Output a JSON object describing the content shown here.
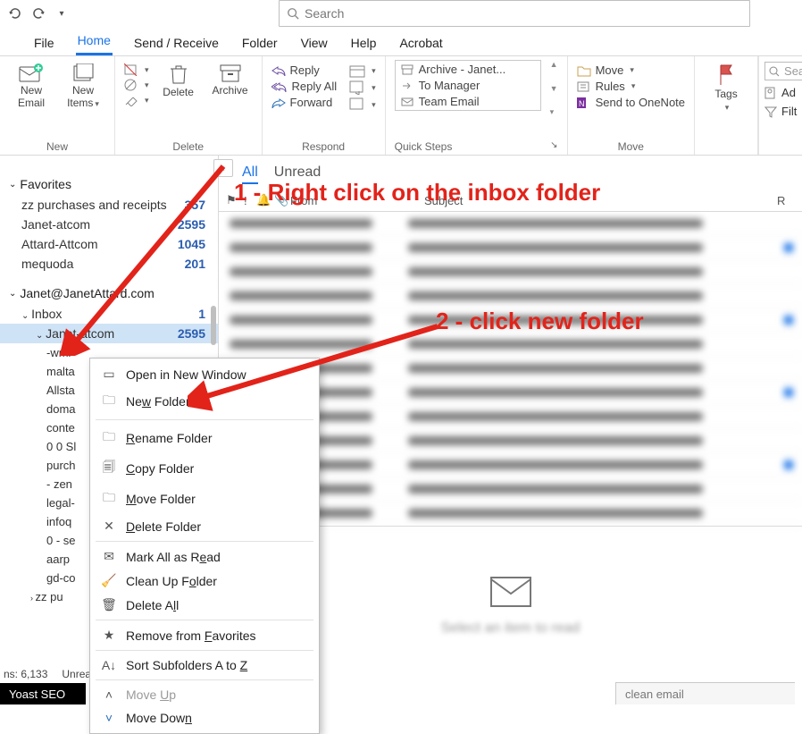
{
  "qat": {
    "search_placeholder": "Search"
  },
  "tabs": {
    "file": "File",
    "home": "Home",
    "sendreceive": "Send / Receive",
    "folder": "Folder",
    "view": "View",
    "help": "Help",
    "acrobat": "Acrobat"
  },
  "ribbon": {
    "new_email": "New Email",
    "new_items": "New Items",
    "delete": "Delete",
    "archive": "Archive",
    "reply": "Reply",
    "reply_all": "Reply All",
    "forward": "Forward",
    "qs_archive": "Archive - Janet...",
    "qs_tomgr": "To Manager",
    "qs_team": "Team Email",
    "move": "Move",
    "rules": "Rules",
    "onenote": "Send to OneNote",
    "tags": "Tags",
    "search_ph": "Search",
    "addr": "Ad",
    "filt": "Filt",
    "grp_new": "New",
    "grp_delete": "Delete",
    "grp_respond": "Respond",
    "grp_qs": "Quick Steps",
    "grp_move": "Move"
  },
  "nav": {
    "favorites_label": "Favorites",
    "fav_items": [
      {
        "label": "zz purchases and receipts",
        "count": "357"
      },
      {
        "label": "Janet-atcom",
        "count": "2595"
      },
      {
        "label": "Attard-Attcom",
        "count": "1045"
      },
      {
        "label": "mequoda",
        "count": "201"
      }
    ],
    "account": "Janet@JanetAttard.com",
    "inbox": {
      "label": "Inbox",
      "count": "1"
    },
    "janet_atcom": {
      "label": "Janet-atcom",
      "count": "2595"
    },
    "subfolders": [
      "-wml",
      "malta",
      "Allsta",
      "doma",
      "conte",
      "0 0 Sl",
      "purch",
      "- zen",
      "legal-",
      "infoq",
      "0 - se",
      "aarp",
      "gd-co"
    ],
    "zzpu": "zz pu"
  },
  "list": {
    "all": "All",
    "unread": "Unread",
    "from": "From",
    "subject": "Subject",
    "rec": "R"
  },
  "reading_hint": "Select an item to read",
  "ctx": {
    "open": "Open in New Window",
    "newfolder": "New Folder...",
    "rename": "Rename Folder",
    "copy": "Copy Folder",
    "move": "Move Folder",
    "delete": "Delete Folder",
    "markread": "Mark All as Read",
    "cleanup": "Clean Up Folder",
    "deleteall": "Delete All",
    "removefav": "Remove from Favorites",
    "sortaz": "Sort Subfolders A to Z",
    "moveup": "Move Up",
    "movedown": "Move Down"
  },
  "anno": {
    "step1": "1 - Right click on the inbox folder",
    "step2": "2 - click new folder"
  },
  "status": {
    "items": "ns: 6,133",
    "unread": "Unread"
  },
  "yoast": "Yoast SEO",
  "cleanemail": "clean email"
}
